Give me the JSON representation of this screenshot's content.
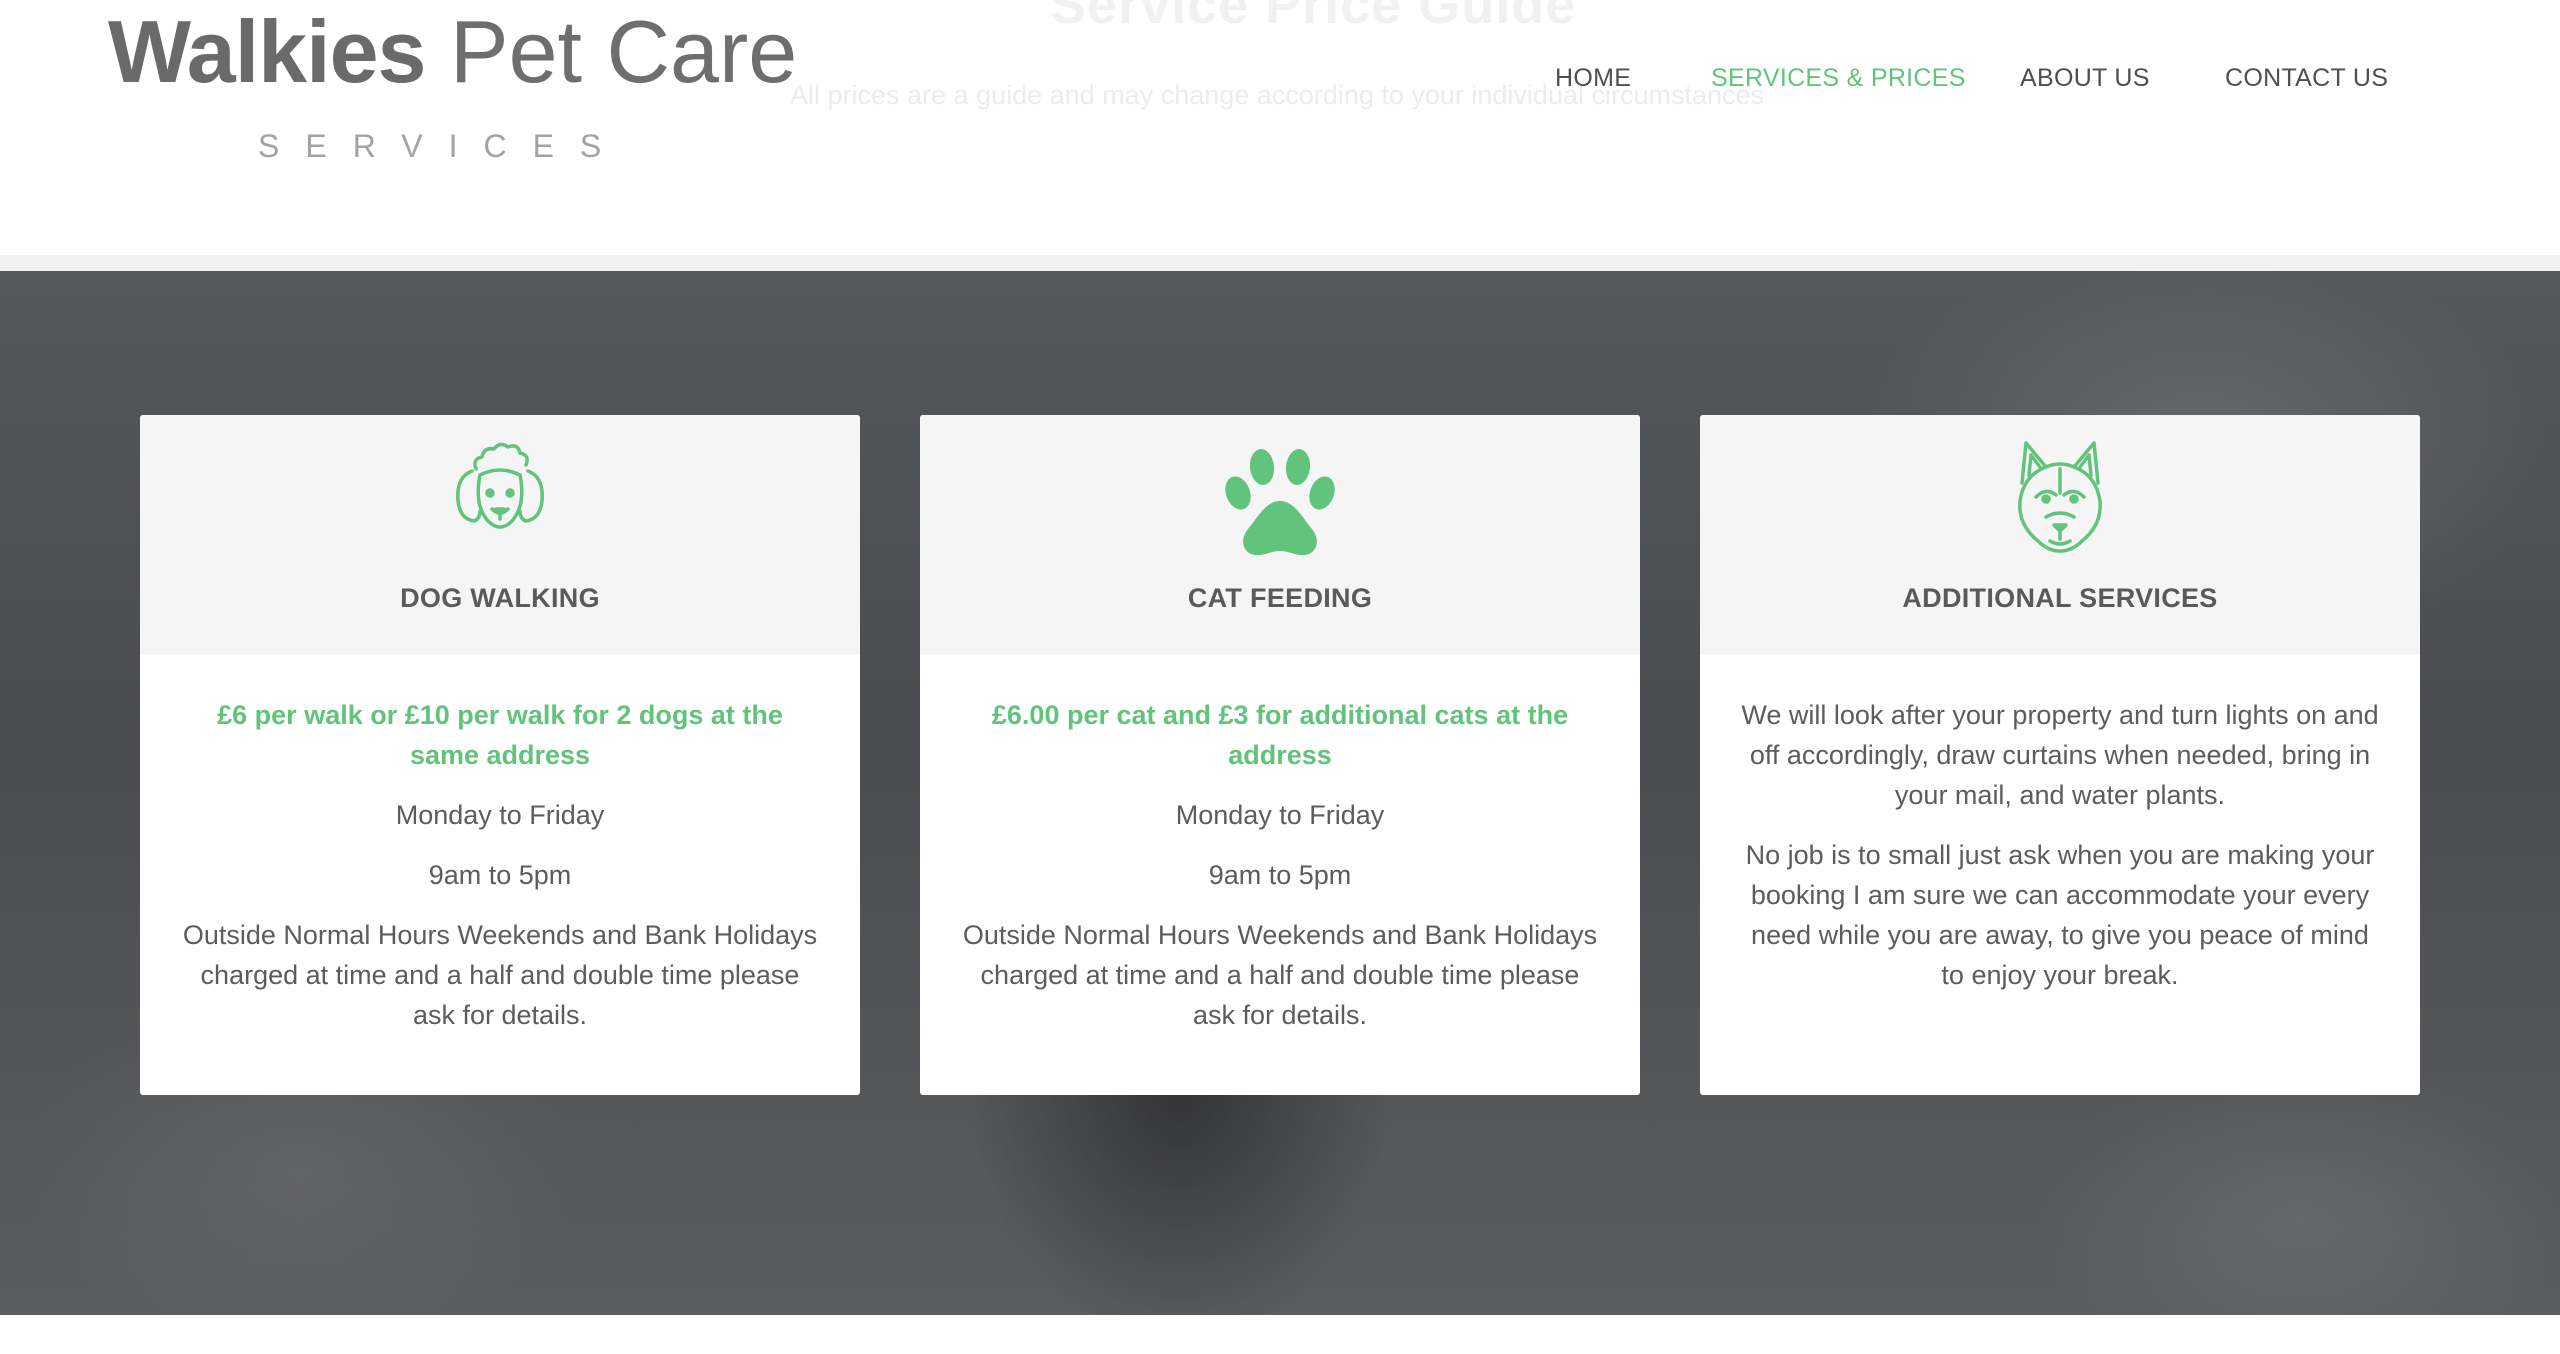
{
  "header": {
    "ghost_title": "Service Price Guide",
    "ghost_subtitle": "All prices are a guide and may change according to your individual circumstances",
    "brand_bold": "Walkies",
    "brand_light": "Pet Care",
    "brand_sub": "SERVICES",
    "nav": [
      {
        "label": "HOME",
        "active": false
      },
      {
        "label": "SERVICES & PRICES",
        "active": true
      },
      {
        "label": "ABOUT US",
        "active": false
      },
      {
        "label": "CONTACT US",
        "active": false
      }
    ],
    "accent_color": "#62c37c"
  },
  "cards": [
    {
      "icon": "poodle-icon",
      "title": "DOG WALKING",
      "price": "£6 per walk or £10 per walk for 2 dogs at the same address",
      "days": "Monday to Friday",
      "hours": "9am to 5pm",
      "note": "Outside Normal Hours Weekends and Bank Holidays charged at time and a half and double time please ask for details."
    },
    {
      "icon": "paw-icon",
      "title": "CAT FEEDING",
      "price": "£6.00 per cat and £3 for additional cats at the address",
      "days": "Monday to Friday",
      "hours": "9am to 5pm",
      "note": "Outside Normal Hours Weekends and Bank Holidays charged at time and a half and double time please ask for details."
    },
    {
      "icon": "husky-icon",
      "title": "ADDITIONAL SERVICES",
      "text1": "We will look after your property and turn lights on and off accordingly, draw curtains when needed, bring in your mail, and water plants.",
      "text2": "No job is to small just ask when you are making your booking I am sure we can accommodate your every need while you are away, to give you peace of mind to enjoy your break."
    }
  ]
}
